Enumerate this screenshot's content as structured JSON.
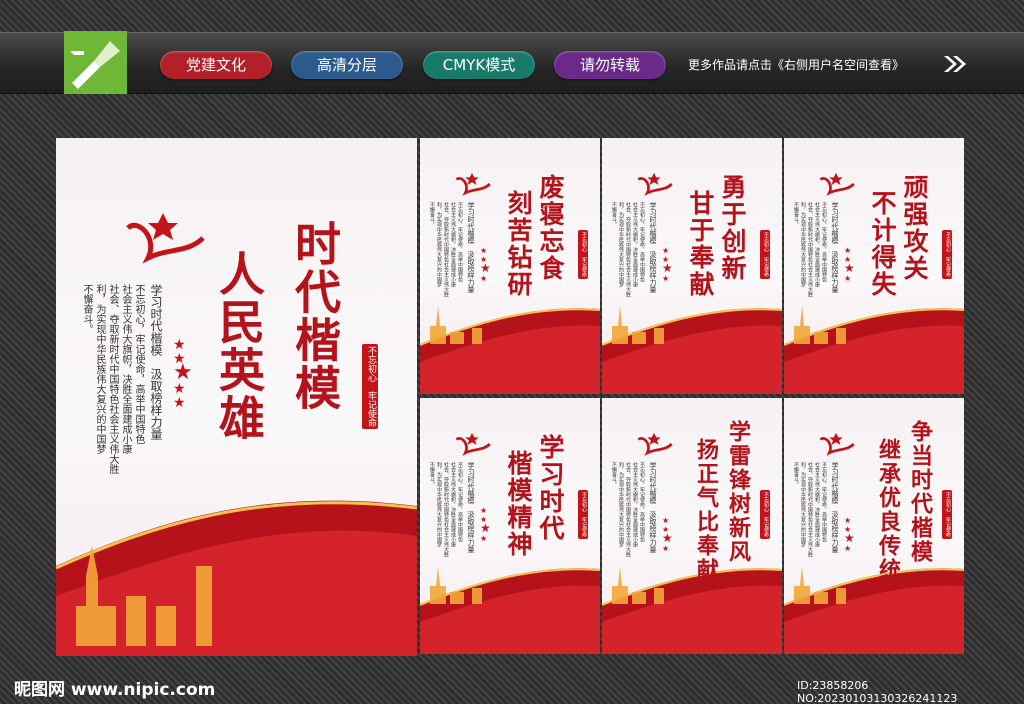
{
  "header": {
    "tags": [
      {
        "label": "党建文化",
        "color": "#b3202a"
      },
      {
        "label": "高清分层",
        "color": "#2c5a8c"
      },
      {
        "label": "CMYK模式",
        "color": "#177a6a"
      },
      {
        "label": "请勿转载",
        "color": "#6a2a8a"
      }
    ],
    "more_text": "更多作品请点击《右侧用户名空间查看》"
  },
  "main_poster": {
    "title_col1": "时代楷模",
    "title_col2": "人民英雄",
    "subtitle": "学习时代楷模　汲取榜样力量",
    "body_col1": "不忘初心，牢记使命，高举中国特色",
    "body_col2": "社会主义伟大旗帜，决胜全面建成小康",
    "body_col3": "社会、夺取新时代中国特色社会主义伟大胜",
    "body_col4": "利，为实现中华民族伟大复兴的中国梦",
    "body_col5": "不懈奋斗。",
    "seal_text": "不忘初心　牢记使命"
  },
  "small_posters": [
    {
      "line1": "废寝忘食",
      "line2": "刻苦钻研"
    },
    {
      "line1": "勇于创新",
      "line2": "甘于奉献"
    },
    {
      "line1": "顽强攻关",
      "line2": "不计得失"
    },
    {
      "line1": "学习时代",
      "line2": "楷模精神"
    },
    {
      "line1": "学雷锋树新风",
      "line2": "扬正气比奉献"
    },
    {
      "line1": "争当时代楷模",
      "line2": "继承优良传统"
    }
  ],
  "small_common": {
    "subtitle": "学习时代楷模　汲取榜样力量",
    "body_col1": "不忘初心，牢记使命，高举中国特色",
    "body_col2": "社会主义伟大旗帜，决胜全面建成小康",
    "body_col3": "社会、夺取新时代中国特色社会主义伟大胜",
    "body_col4": "利，为实现中华民族伟大复兴的中国梦",
    "body_col5": "不懈奋斗。",
    "seal_text": "不忘初心　牢记使命"
  },
  "footer": {
    "site": "昵图网 www.nipic.com",
    "id_text": "ID:23858206 NO:20230103130326241123"
  }
}
